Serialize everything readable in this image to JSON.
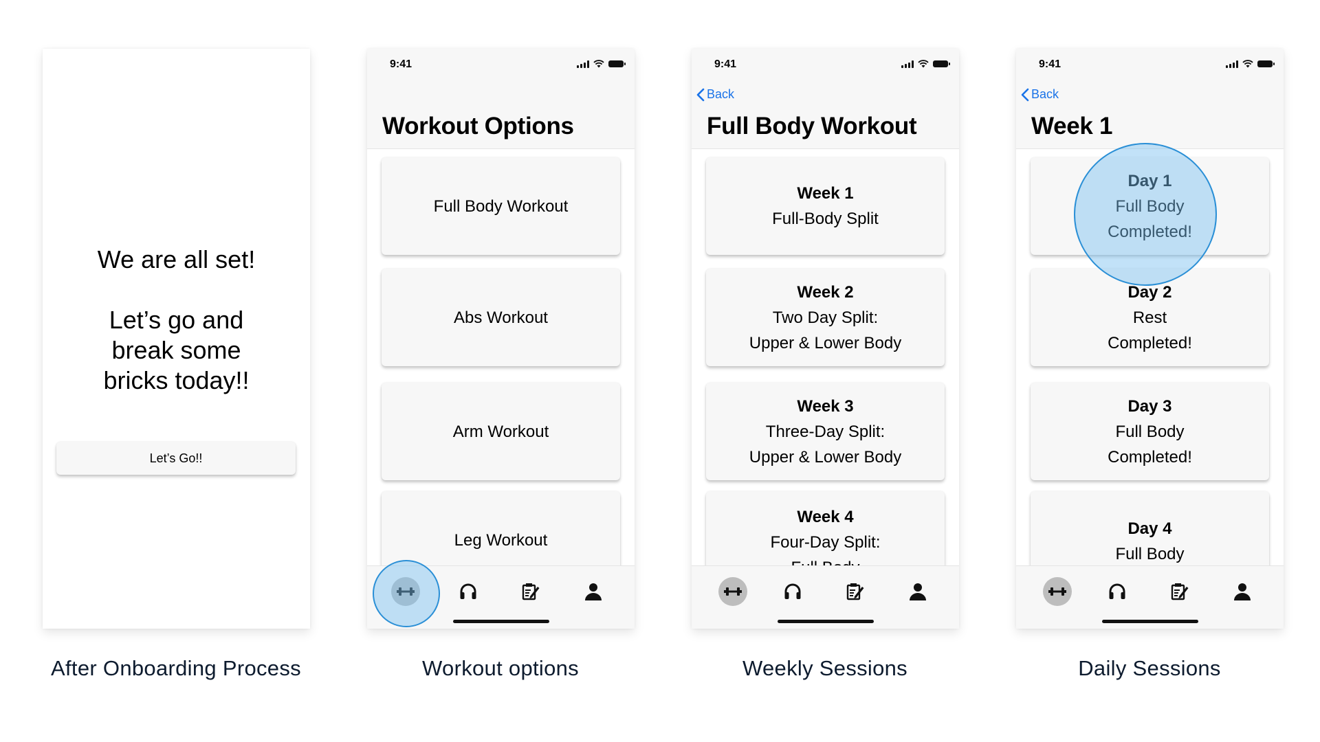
{
  "status_bar": {
    "time": "9:41"
  },
  "onboarding": {
    "line1": "We are all set!",
    "line2": "Let’s go and",
    "line3": "break some",
    "line4": "bricks today!!",
    "button": "Let’s Go!!"
  },
  "workout_options": {
    "title": "Workout Options",
    "items": [
      "Full Body Workout",
      "Abs Workout",
      "Arm Workout",
      "Leg Workout"
    ]
  },
  "weekly_sessions": {
    "back": "Back",
    "title": "Full Body Workout",
    "weeks": [
      {
        "name": "Week 1",
        "line1": "Full-Body Split",
        "line2": ""
      },
      {
        "name": "Week 2",
        "line1": "Two Day Split:",
        "line2": "Upper & Lower Body"
      },
      {
        "name": "Week 3",
        "line1": "Three-Day Split:",
        "line2": "Upper & Lower Body"
      },
      {
        "name": "Week 4",
        "line1": "Four-Day Split:",
        "line2": "Full Body"
      }
    ]
  },
  "daily_sessions": {
    "back": "Back",
    "title": "Week 1",
    "days": [
      {
        "name": "Day 1",
        "type": "Full Body",
        "status": "Completed!"
      },
      {
        "name": "Day 2",
        "type": "Rest",
        "status": "Completed!"
      },
      {
        "name": "Day 3",
        "type": "Full Body",
        "status": "Completed!"
      },
      {
        "name": "Day 4",
        "type": "Full Body",
        "status": ""
      }
    ]
  },
  "tabbar": {
    "icons": [
      "dumbbell-icon",
      "headphones-icon",
      "notepad-icon",
      "person-icon"
    ]
  },
  "captions": [
    "After Onboarding Process",
    "Workout options",
    "Weekly Sessions",
    "Daily Sessions"
  ],
  "colors": {
    "accent": "#1a73e8",
    "highlight": "#2a8fd6",
    "card": "#f7f7f7",
    "active_tab": "#bdbdbd"
  }
}
